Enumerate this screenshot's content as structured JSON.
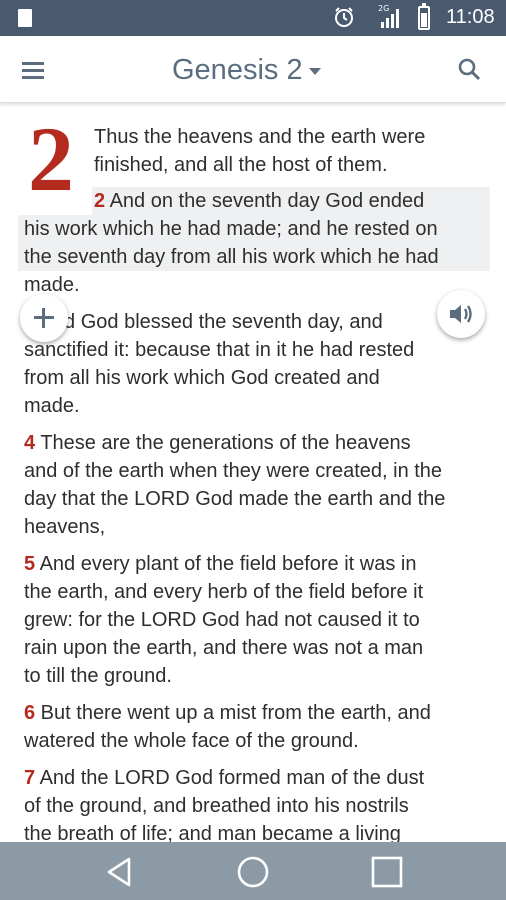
{
  "status_bar": {
    "time": "11:08",
    "network_label": "2G",
    "icons": [
      "notification-icon",
      "alarm-clock-icon",
      "signal-icon",
      "battery-icon"
    ]
  },
  "app_bar": {
    "title": "Genesis 2",
    "icons": [
      "menu-icon",
      "dropdown-caret-icon",
      "search-icon"
    ]
  },
  "reader": {
    "chapter_number": "2",
    "lines": [
      {
        "num": "",
        "text": "Thus the heavens and the earth were"
      },
      {
        "num": "",
        "text": "finished, and all the host of them."
      },
      {
        "num": "2",
        "text": " And on the seventh day God ended"
      },
      {
        "num": "",
        "text": "his work which he had made; and he rested on"
      },
      {
        "num": "",
        "text": "the seventh day from all his work which he had"
      },
      {
        "num": "",
        "text": "made."
      },
      {
        "num": "3",
        "text": " And God blessed the seventh day, and"
      },
      {
        "num": "",
        "text": "sanctified it: because that in it he had rested"
      },
      {
        "num": "",
        "text": "from all his work which God created and"
      },
      {
        "num": "",
        "text": "made."
      },
      {
        "num": "4",
        "text": " These are the generations of the heavens"
      },
      {
        "num": "",
        "text": "and of the earth when they were created, in the"
      },
      {
        "num": "",
        "text": "day that the LORD God made the earth and the"
      },
      {
        "num": "",
        "text": "heavens,"
      },
      {
        "num": "5",
        "text": " And every plant of the field before it was in"
      },
      {
        "num": "",
        "text": "the earth, and every herb of the field before it"
      },
      {
        "num": "",
        "text": "grew: for the LORD God had not caused it to"
      },
      {
        "num": "",
        "text": "rain upon the earth, and there was not a man"
      },
      {
        "num": "",
        "text": "to till the ground."
      },
      {
        "num": "6",
        "text": " But there went up a mist from the earth, and"
      },
      {
        "num": "",
        "text": "watered the whole face of the ground."
      },
      {
        "num": "7",
        "text": " And the LORD God formed man of the dust"
      },
      {
        "num": "",
        "text": "of the ground, and breathed into his nostrils"
      },
      {
        "num": "",
        "text": "the breath of life; and man became a living"
      }
    ],
    "highlighted_verse": "2",
    "floating_buttons": [
      "add-icon",
      "speaker-icon"
    ]
  },
  "nav_bar": {
    "icons": [
      "back-triangle-icon",
      "home-circle-icon",
      "recent-apps-square-icon"
    ]
  },
  "colors": {
    "status_bar_bg": "#4a5a6e",
    "accent_text": "#5b6d7e",
    "verse_number": "#b52a1f",
    "highlight_bg": "#eef0f2",
    "nav_bar_bg": "#8c9aa6"
  }
}
